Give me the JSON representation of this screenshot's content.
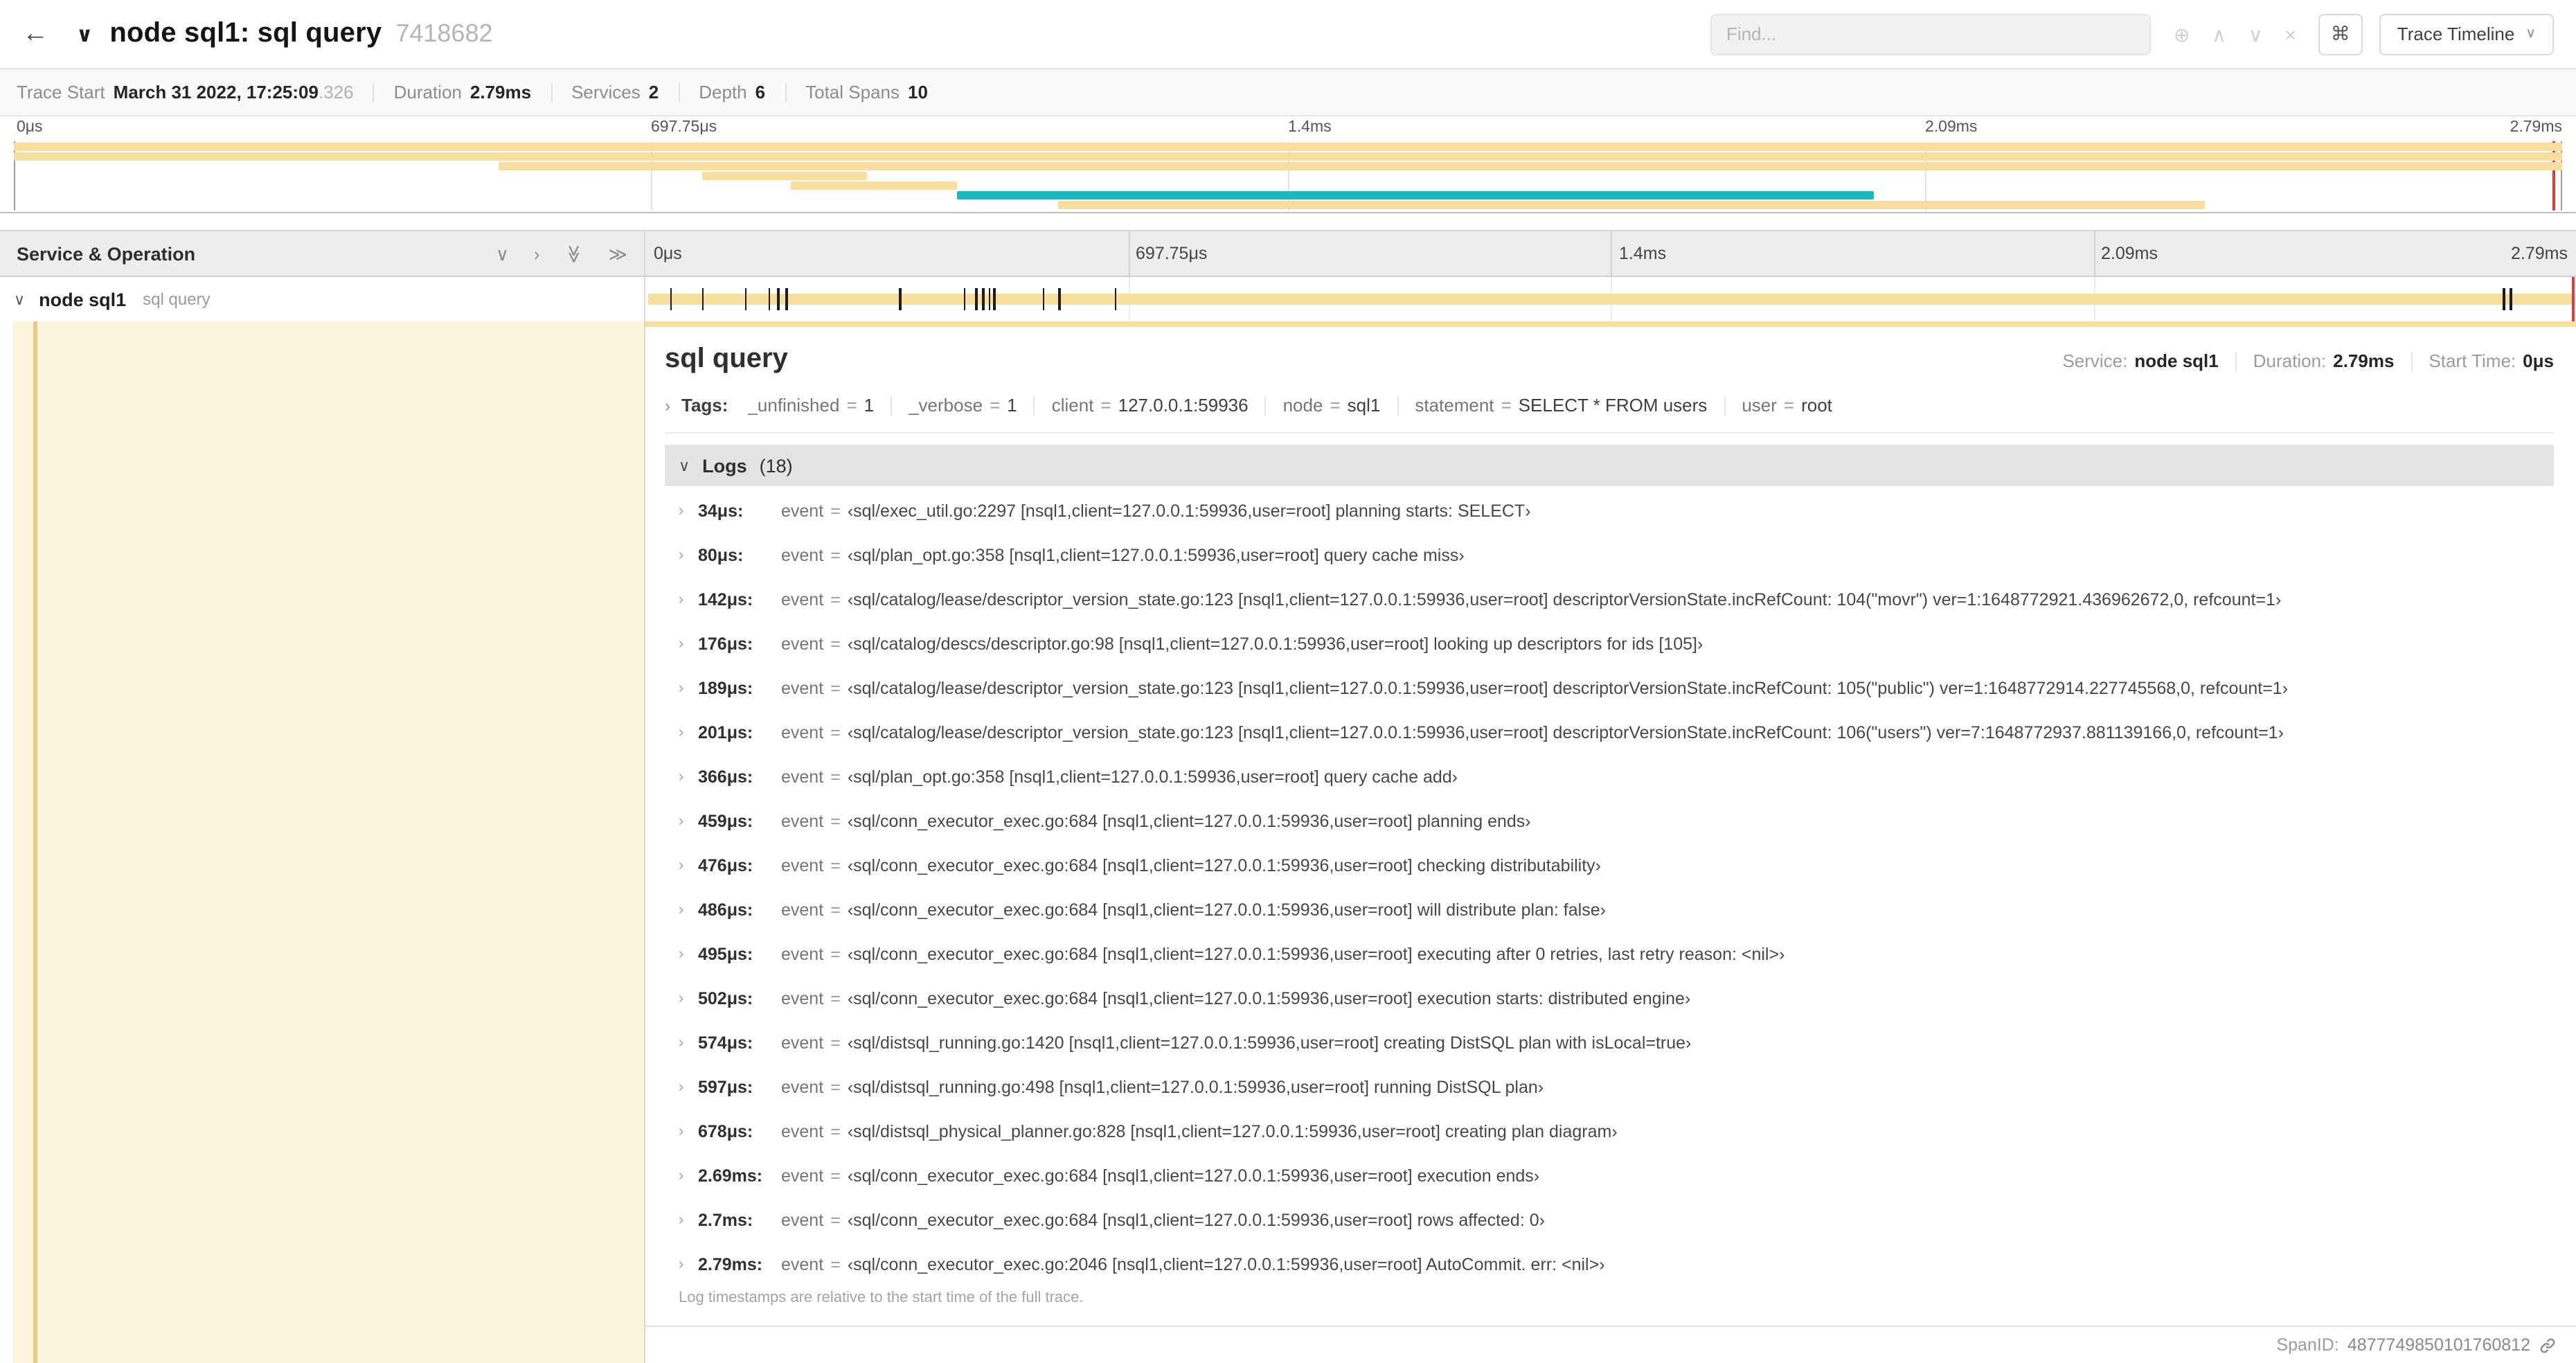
{
  "palette": {
    "tan": "#F7DE9C",
    "teal": "#17B8BE",
    "red": "#DD3E34",
    "cream": "#FCF5DD",
    "guide": "#E8CC82"
  },
  "icons": {
    "back": "←",
    "collapse": "∨",
    "focus": "⊕",
    "prev": "∧",
    "next": "∨",
    "clear": "×",
    "caret": "∨",
    "chevron_right": "›",
    "chevron_down": "∨",
    "double_chevron": "≫"
  },
  "header": {
    "title": "node sql1: sql query",
    "trace_id": "7418682",
    "find_placeholder": "Find...",
    "shortcut_button": "⌘",
    "view_button": "Trace Timeline"
  },
  "summary": {
    "items": [
      {
        "label": "Trace Start",
        "value": "March 31 2022, 17:25:09",
        "suffix": ".326"
      },
      {
        "label": "Duration",
        "value": "2.79ms"
      },
      {
        "label": "Services",
        "value": "2"
      },
      {
        "label": "Depth",
        "value": "6"
      },
      {
        "label": "Total Spans",
        "value": "10"
      }
    ]
  },
  "minimap": {
    "ticks": [
      "0μs",
      "697.75μs",
      "1.4ms",
      "2.09ms",
      "2.79ms"
    ],
    "bars": [
      {
        "start": 0,
        "end": 100,
        "color": "tan"
      },
      {
        "start": 0,
        "end": 100,
        "color": "tan"
      },
      {
        "start": 19,
        "end": 100,
        "color": "tan"
      },
      {
        "start": 27,
        "end": 33.5,
        "color": "tan"
      },
      {
        "start": 30.5,
        "end": 37,
        "color": "tan"
      },
      {
        "start": 37,
        "end": 73,
        "color": "teal"
      },
      {
        "start": 41,
        "end": 86,
        "color": "tan"
      }
    ]
  },
  "timeline": {
    "header_label": "Service & Operation",
    "ticks": [
      "0μs",
      "697.75μs",
      "1.4ms",
      "2.09ms",
      "2.79ms"
    ],
    "total_duration": "2.79ms",
    "row": {
      "service": "node sql1",
      "operation": "sql query"
    }
  },
  "detail": {
    "title": "sql query",
    "meta": [
      {
        "label": "Service:",
        "value": "node sql1"
      },
      {
        "label": "Duration:",
        "value": "2.79ms"
      },
      {
        "label": "Start Time:",
        "value": "0μs"
      }
    ],
    "tags_label": "Tags:",
    "eq": "=",
    "tags": [
      {
        "key": "_unfinished",
        "value": "1"
      },
      {
        "key": "_verbose",
        "value": "1"
      },
      {
        "key": "client",
        "value": "127.0.0.1:59936"
      },
      {
        "key": "node",
        "value": "sql1"
      },
      {
        "key": "statement",
        "value": "SELECT * FROM users"
      },
      {
        "key": "user",
        "value": "root"
      }
    ],
    "logs_label": "Logs",
    "logs_count": "(18)",
    "logs": [
      {
        "time": "34μs:",
        "key": "event",
        "value": "‹sql/exec_util.go:2297 [nsql1,client=127.0.0.1:59936,user=root] planning starts: SELECT›"
      },
      {
        "time": "80μs:",
        "key": "event",
        "value": "‹sql/plan_opt.go:358 [nsql1,client=127.0.0.1:59936,user=root] query cache miss›"
      },
      {
        "time": "142μs:",
        "key": "event",
        "value": "‹sql/catalog/lease/descriptor_version_state.go:123 [nsql1,client=127.0.0.1:59936,user=root] descriptorVersionState.incRefCount: 104(\"movr\") ver=1:1648772921.436962672,0, refcount=1›"
      },
      {
        "time": "176μs:",
        "key": "event",
        "value": "‹sql/catalog/descs/descriptor.go:98 [nsql1,client=127.0.0.1:59936,user=root] looking up descriptors for ids [105]›"
      },
      {
        "time": "189μs:",
        "key": "event",
        "value": "‹sql/catalog/lease/descriptor_version_state.go:123 [nsql1,client=127.0.0.1:59936,user=root] descriptorVersionState.incRefCount: 105(\"public\") ver=1:1648772914.227745568,0, refcount=1›"
      },
      {
        "time": "201μs:",
        "key": "event",
        "value": "‹sql/catalog/lease/descriptor_version_state.go:123 [nsql1,client=127.0.0.1:59936,user=root] descriptorVersionState.incRefCount: 106(\"users\") ver=7:1648772937.881139166,0, refcount=1›"
      },
      {
        "time": "366μs:",
        "key": "event",
        "value": "‹sql/plan_opt.go:358 [nsql1,client=127.0.0.1:59936,user=root] query cache add›"
      },
      {
        "time": "459μs:",
        "key": "event",
        "value": "‹sql/conn_executor_exec.go:684 [nsql1,client=127.0.0.1:59936,user=root] planning ends›"
      },
      {
        "time": "476μs:",
        "key": "event",
        "value": "‹sql/conn_executor_exec.go:684 [nsql1,client=127.0.0.1:59936,user=root] checking distributability›"
      },
      {
        "time": "486μs:",
        "key": "event",
        "value": "‹sql/conn_executor_exec.go:684 [nsql1,client=127.0.0.1:59936,user=root] will distribute plan: false›"
      },
      {
        "time": "495μs:",
        "key": "event",
        "value": "‹sql/conn_executor_exec.go:684 [nsql1,client=127.0.0.1:59936,user=root] executing after 0 retries, last retry reason: <nil>›"
      },
      {
        "time": "502μs:",
        "key": "event",
        "value": "‹sql/conn_executor_exec.go:684 [nsql1,client=127.0.0.1:59936,user=root] execution starts: distributed engine›"
      },
      {
        "time": "574μs:",
        "key": "event",
        "value": "‹sql/distsql_running.go:1420 [nsql1,client=127.0.0.1:59936,user=root] creating DistSQL plan with isLocal=true›"
      },
      {
        "time": "597μs:",
        "key": "event",
        "value": "‹sql/distsql_running.go:498 [nsql1,client=127.0.0.1:59936,user=root] running DistSQL plan›"
      },
      {
        "time": "678μs:",
        "key": "event",
        "value": "‹sql/distsql_physical_planner.go:828 [nsql1,client=127.0.0.1:59936,user=root] creating plan diagram›"
      },
      {
        "time": "2.69ms:",
        "key": "event",
        "value": "‹sql/conn_executor_exec.go:684 [nsql1,client=127.0.0.1:59936,user=root] execution ends›"
      },
      {
        "time": "2.7ms:",
        "key": "event",
        "value": "‹sql/conn_executor_exec.go:684 [nsql1,client=127.0.0.1:59936,user=root] rows affected: 0›"
      },
      {
        "time": "2.79ms:",
        "key": "event",
        "value": "‹sql/conn_executor_exec.go:2046 [nsql1,client=127.0.0.1:59936,user=root] AutoCommit. err: <nil>›"
      }
    ],
    "footnote": "Log timestamps are relative to the start time of the full trace.",
    "span_id_label": "SpanID:",
    "span_id": "4877749850101760812"
  }
}
